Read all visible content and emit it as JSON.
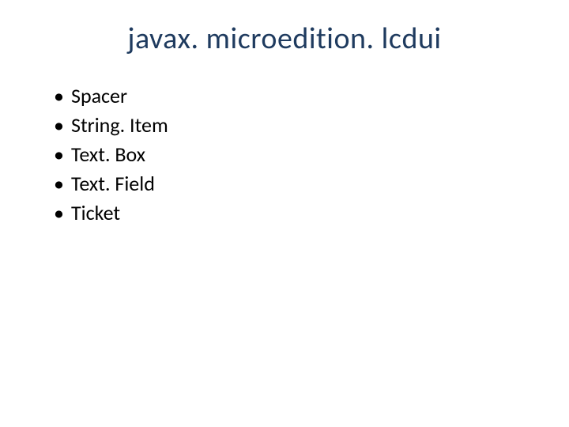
{
  "title": "javax. microedition. lcdui",
  "items": [
    "Spacer",
    "String. Item",
    "Text. Box",
    "Text. Field",
    "Ticket"
  ]
}
